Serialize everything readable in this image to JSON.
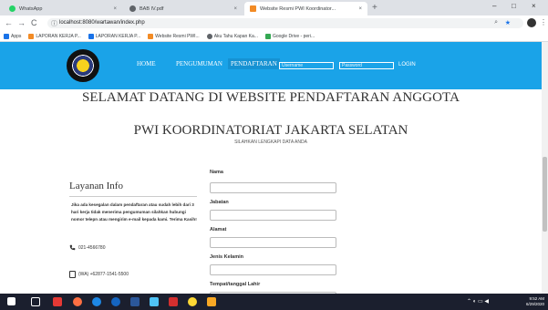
{
  "browser": {
    "tabs": [
      {
        "label": "WhatsApp",
        "close": "×",
        "favicon_color": "#25d366"
      },
      {
        "label": "BAB IV.pdf",
        "close": "×",
        "favicon_color": "#5f6368"
      },
      {
        "label": "Website Resmi PWI Koordinator...",
        "close": "×",
        "favicon_color": "#f28b25"
      }
    ],
    "new_tab": "+",
    "window_controls": {
      "minimize": "–",
      "maximize": "□",
      "close": "×"
    },
    "nav": {
      "back": "←",
      "forward": "→",
      "reload": "C"
    },
    "url": "localhost:8080/wartawan/index.php",
    "bookmarks": [
      {
        "label": "Apps",
        "color": "#1a73e8"
      },
      {
        "label": "LAPORAN KERJA P...",
        "color": "#f28b25"
      },
      {
        "label": "LAPORAN KERJA P...",
        "color": "#1a73e8"
      },
      {
        "label": "Website Resmi PWI...",
        "color": "#f28b25"
      },
      {
        "label": "Aku Tahu Kapan Ka...",
        "color": "#5f6368"
      },
      {
        "label": "Google Drive - peri...",
        "color": "#34a853"
      }
    ]
  },
  "site": {
    "nav": {
      "home": "HOME",
      "news": "PENGUMUMAN",
      "register": "PENDAFTARAN",
      "username_placeholder": "Username",
      "password_placeholder": "Password",
      "login": "LOGIN"
    },
    "heading_line1": "SELAMAT DATANG DI WEBSITE PENDAFTARAN ANGGOTA",
    "heading_line2": "PWI KOORDINATORIAT JAKARTA SELATAN",
    "subheading": "SILAHKAN LENGKAPI DATA ANDA",
    "info": {
      "title": "Layanan Info",
      "text": "Jika ada kesegalan dalam pendaftaran atau sudah lebih dari 3 hari kerja tidak menerima pengumuman silahkan hubungi nomor telepn atau mengirim e-mail kepada kami. Terima Kasih!",
      "phone": "021-4566780",
      "whatsapp": "(WA) +62877-1541-5500"
    },
    "form": {
      "labels": [
        "Nama",
        "Jabatan",
        "Alamat",
        "Jenis Kelamin",
        "Tempat/tanggal Lahir"
      ]
    }
  },
  "taskbar": {
    "time": "9:52 AM",
    "date": "6/29/2020"
  }
}
